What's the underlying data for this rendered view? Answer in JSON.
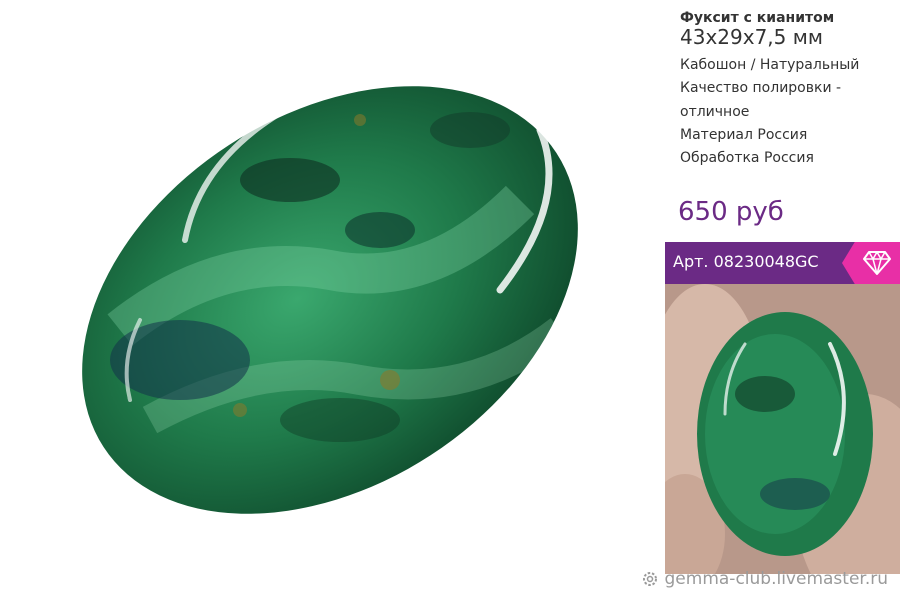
{
  "product": {
    "title": "Фуксит с кианитом",
    "size": "43х29х7,5 мм",
    "specs": [
      "Кабошон / Натуральный",
      "Качество полировки -",
      "отличное",
      "Материал Россия",
      "Обработка Россия"
    ],
    "price": "650 руб",
    "article": "Арт. 08230048GC"
  },
  "icons": {
    "badge": "diamond-icon",
    "watermark": "gear-icon"
  },
  "colors": {
    "brand_purple": "#6b2a85",
    "badge_pink": "#e82fa6",
    "stone_green": "#1f7a4a"
  },
  "footer": {
    "watermark": "gemma-club.livemaster.ru"
  }
}
